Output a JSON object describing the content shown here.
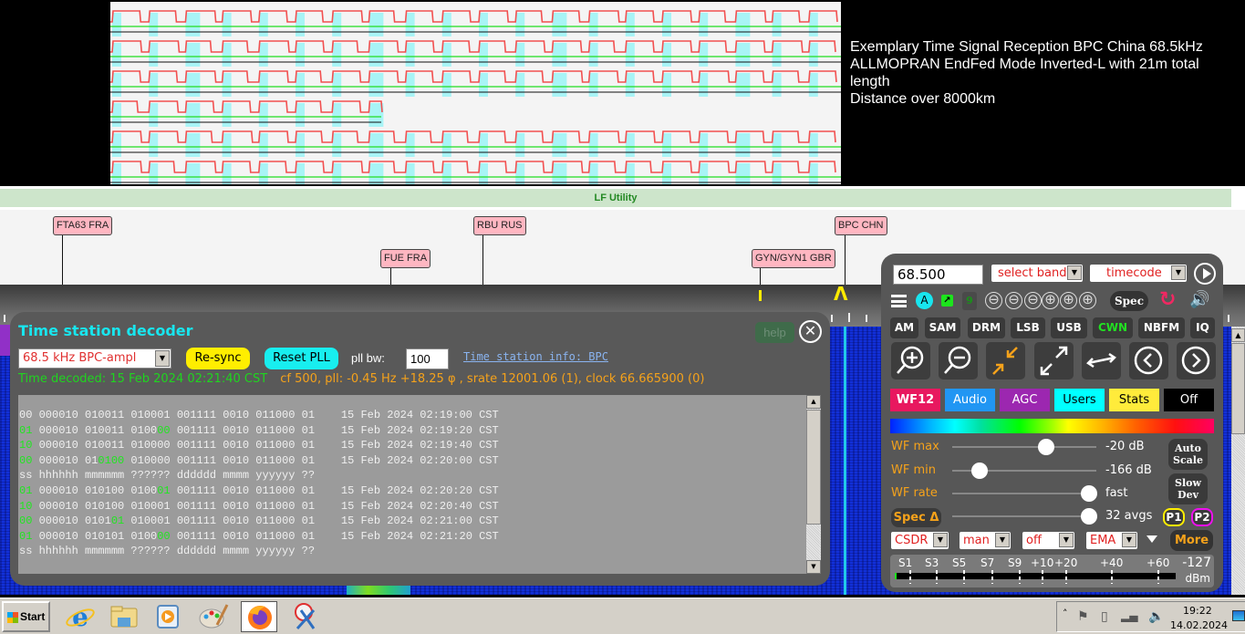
{
  "banner": {
    "lines": [
      "Exemplary Time Signal Reception BPC China 68.5kHz",
      "ALLMOPRAN EndFed Mode Inverted-L with 21m total length",
      "Distance over 8000km"
    ]
  },
  "band_bar": {
    "label": "LF Utility",
    "color": "#cde5cb"
  },
  "stations": [
    {
      "label": "FTA63 FRA"
    },
    {
      "label": "FUE FRA"
    },
    {
      "label": "RBU RUS"
    },
    {
      "label": "GYN/GYN1 GBR"
    },
    {
      "label": "BPC CHN"
    }
  ],
  "decoder": {
    "title": "Time station decoder",
    "help_label": "help",
    "close_icon": "close-circle-icon",
    "station_select": "68.5 kHz BPC-ampl",
    "resync_label": "Re-sync",
    "reset_pll_label": "Reset PLL",
    "pll_bw_label": "pll bw:",
    "pll_bw_value": "100",
    "info_link": "Time station info: BPC",
    "time_decoded": "Time decoded: 15 Feb 2024 02:21:40 CST",
    "pll_status": "cf 500, pll: -0.45 Hz +18.25 φ , srate 12001.06 (1), clock 66.665900 (0)",
    "log": {
      "header": "ss hhhhhh mmmmmm ?????? dddddd mmmm yyyyyy ??",
      "rows": [
        {
          "ss": "00",
          "ss_hl": false,
          "hh": "000010",
          "mm_pre": "010011",
          "mm_hl": "",
          "q_pre": "010001",
          "q_hl": "",
          "dd": "001111",
          "mo": "0010",
          "yy": "011000",
          "x": "01",
          "decoded": "15 Feb 2024 02:19:00 CST"
        },
        {
          "ss": "01",
          "ss_hl": true,
          "hh": "000010",
          "mm_pre": "010011",
          "mm_hl": "",
          "q_pre": "0100",
          "q_hl": "00",
          "dd": "001111",
          "mo": "0010",
          "yy": "011000",
          "x": "01",
          "decoded": "15 Feb 2024 02:19:20 CST"
        },
        {
          "ss": "10",
          "ss_hl": true,
          "hh": "000010",
          "mm_pre": "010011",
          "mm_hl": "",
          "q_pre": "010000",
          "q_hl": "",
          "dd": "001111",
          "mo": "0010",
          "yy": "011000",
          "x": "01",
          "decoded": "15 Feb 2024 02:19:40 CST"
        },
        {
          "ss": "00",
          "ss_hl": true,
          "hh": "000010",
          "mm_pre": "01",
          "mm_hl": "0100",
          "q_pre": "010000",
          "q_hl": "",
          "dd": "001111",
          "mo": "0010",
          "yy": "011000",
          "x": "01",
          "decoded": "15 Feb 2024 02:20:00 CST"
        },
        {
          "header": true
        },
        {
          "ss": "01",
          "ss_hl": true,
          "hh": "000010",
          "mm_pre": "010100",
          "mm_hl": "",
          "q_pre": "0100",
          "q_hl": "01",
          "dd": "001111",
          "mo": "0010",
          "yy": "011000",
          "x": "01",
          "decoded": "15 Feb 2024 02:20:20 CST"
        },
        {
          "ss": "10",
          "ss_hl": true,
          "hh": "000010",
          "mm_pre": "010100",
          "mm_hl": "",
          "q_pre": "010001",
          "q_hl": "",
          "dd": "001111",
          "mo": "0010",
          "yy": "011000",
          "x": "01",
          "decoded": "15 Feb 2024 02:20:40 CST"
        },
        {
          "ss": "00",
          "ss_hl": true,
          "hh": "000010",
          "mm_pre": "0101",
          "mm_hl": "01",
          "q_pre": "010001",
          "q_hl": "",
          "dd": "001111",
          "mo": "0010",
          "yy": "011000",
          "x": "01",
          "decoded": "15 Feb 2024 02:21:00 CST"
        },
        {
          "ss": "01",
          "ss_hl": true,
          "hh": "000010",
          "mm_pre": "010101",
          "mm_hl": "",
          "q_pre": "0100",
          "q_hl": "00",
          "dd": "001111",
          "mo": "0010",
          "yy": "011000",
          "x": "01",
          "decoded": "15 Feb 2024 02:21:20 CST"
        },
        {
          "header": true
        }
      ]
    }
  },
  "control_panel": {
    "frequency": "68.500",
    "band_select": "select band",
    "extension_select": "timecode",
    "a_label": "A",
    "nine_label": "9",
    "zoom_steps": [
      "⊖",
      "⊖",
      "⊖",
      "⊕",
      "⊕",
      "⊕"
    ],
    "spec_label": "Spec",
    "modes": [
      {
        "label": "AM",
        "active": false
      },
      {
        "label": "SAM",
        "active": false
      },
      {
        "label": "DRM",
        "active": false
      },
      {
        "label": "LSB",
        "active": false
      },
      {
        "label": "USB",
        "active": false
      },
      {
        "label": "CWN",
        "active": true
      },
      {
        "label": "NBFM",
        "active": false
      },
      {
        "label": "IQ",
        "active": false
      }
    ],
    "tools": [
      "zoom-in-icon",
      "zoom-out-icon",
      "zoom-to-band-icon",
      "zoom-max-icon",
      "swap-icon",
      "page-left-icon",
      "page-right-icon"
    ],
    "tabs": [
      {
        "label": "WF12",
        "bg": "#e8185f",
        "fg": "#ffffff"
      },
      {
        "label": "Audio",
        "bg": "#2196f3",
        "fg": "#ffffff"
      },
      {
        "label": "AGC",
        "bg": "#9c27b0",
        "fg": "#ffffff"
      },
      {
        "label": "Users",
        "bg": "#00ffff",
        "fg": "#000000"
      },
      {
        "label": "Stats",
        "bg": "#ffeb3b",
        "fg": "#000000"
      },
      {
        "label": "Off",
        "bg": "#000000",
        "fg": "#ffffff"
      }
    ],
    "sliders": [
      {
        "label": "WF max",
        "value": "-20 dB",
        "position": 0.65
      },
      {
        "label": "WF min",
        "value": "-166 dB",
        "position": 0.19
      },
      {
        "label": "WF rate",
        "value": "fast",
        "position": 0.95
      },
      {
        "label": "Spec Δ",
        "value": "32 avgs",
        "position": 0.95
      }
    ],
    "auto_scale_label": "Auto Scale",
    "slow_dev_label": "Slow Dev",
    "p1_label": "P1",
    "p2_label": "P2",
    "selects": [
      "CSDR",
      "man",
      "off",
      "EMA"
    ],
    "more_label": "More",
    "smeter": {
      "marks": [
        "S1",
        "S3",
        "S5",
        "S7",
        "S9",
        "+10",
        "+20",
        "+40",
        "+60"
      ],
      "dbm_value": "-127",
      "unit": "dBm",
      "level": 0.005
    }
  },
  "taskbar": {
    "start_label": "Start",
    "apps": [
      "internet-explorer-icon",
      "file-explorer-icon",
      "media-player-icon",
      "paint-icon",
      "firefox-icon",
      "snipping-tool-icon"
    ],
    "active_app": "firefox-icon",
    "time": "19:22",
    "date": "14.02.2024"
  }
}
